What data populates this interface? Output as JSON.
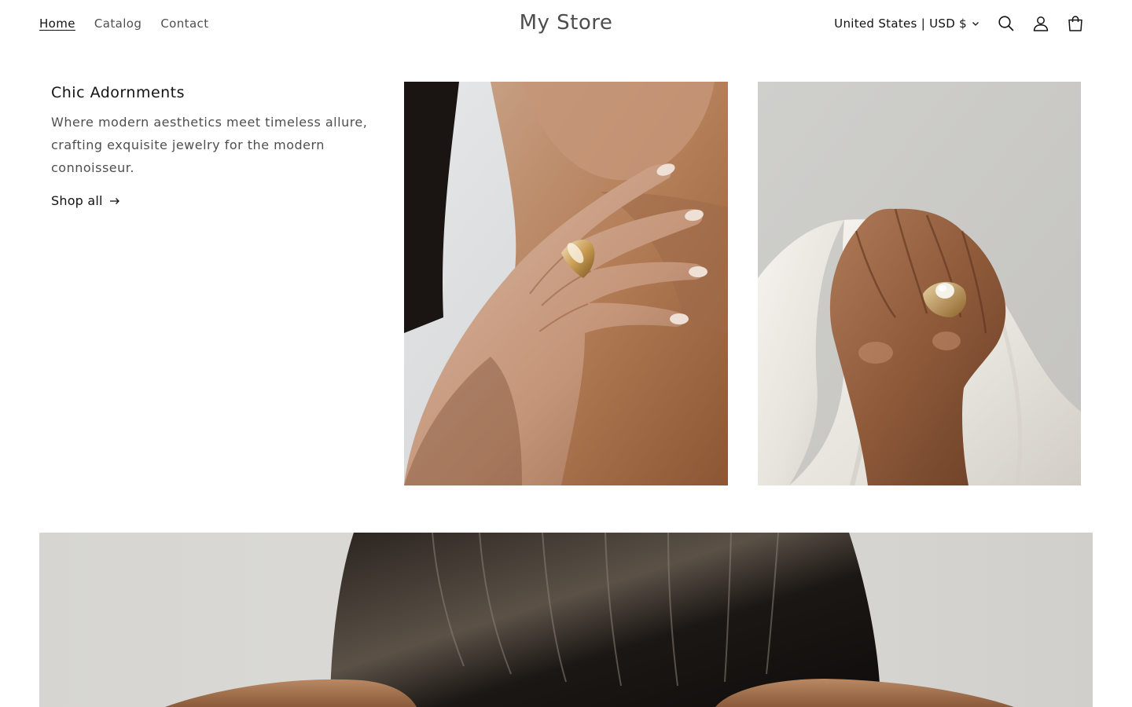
{
  "header": {
    "nav": [
      {
        "label": "Home",
        "active": true
      },
      {
        "label": "Catalog",
        "active": false
      },
      {
        "label": "Contact",
        "active": false
      }
    ],
    "logo": "My Store",
    "currency_selector": "United States | USD $",
    "icons": [
      "search-icon",
      "account-icon",
      "cart-icon"
    ]
  },
  "collage": {
    "heading": "Chic Adornments",
    "description": "Where modern aesthetics meet timeless allure, crafting exquisite jewelry for the modern connoisseur.",
    "link_label": "Shop all",
    "images": [
      {
        "name": "hand-with-gold-ring-at-neck-image"
      },
      {
        "name": "hand-with-pearl-ring-on-white-fabric-image"
      }
    ]
  },
  "banner": {
    "image": {
      "name": "dark-hair-bare-shoulders-image"
    }
  },
  "colors": {
    "text": "#121212",
    "background": "#ffffff"
  }
}
